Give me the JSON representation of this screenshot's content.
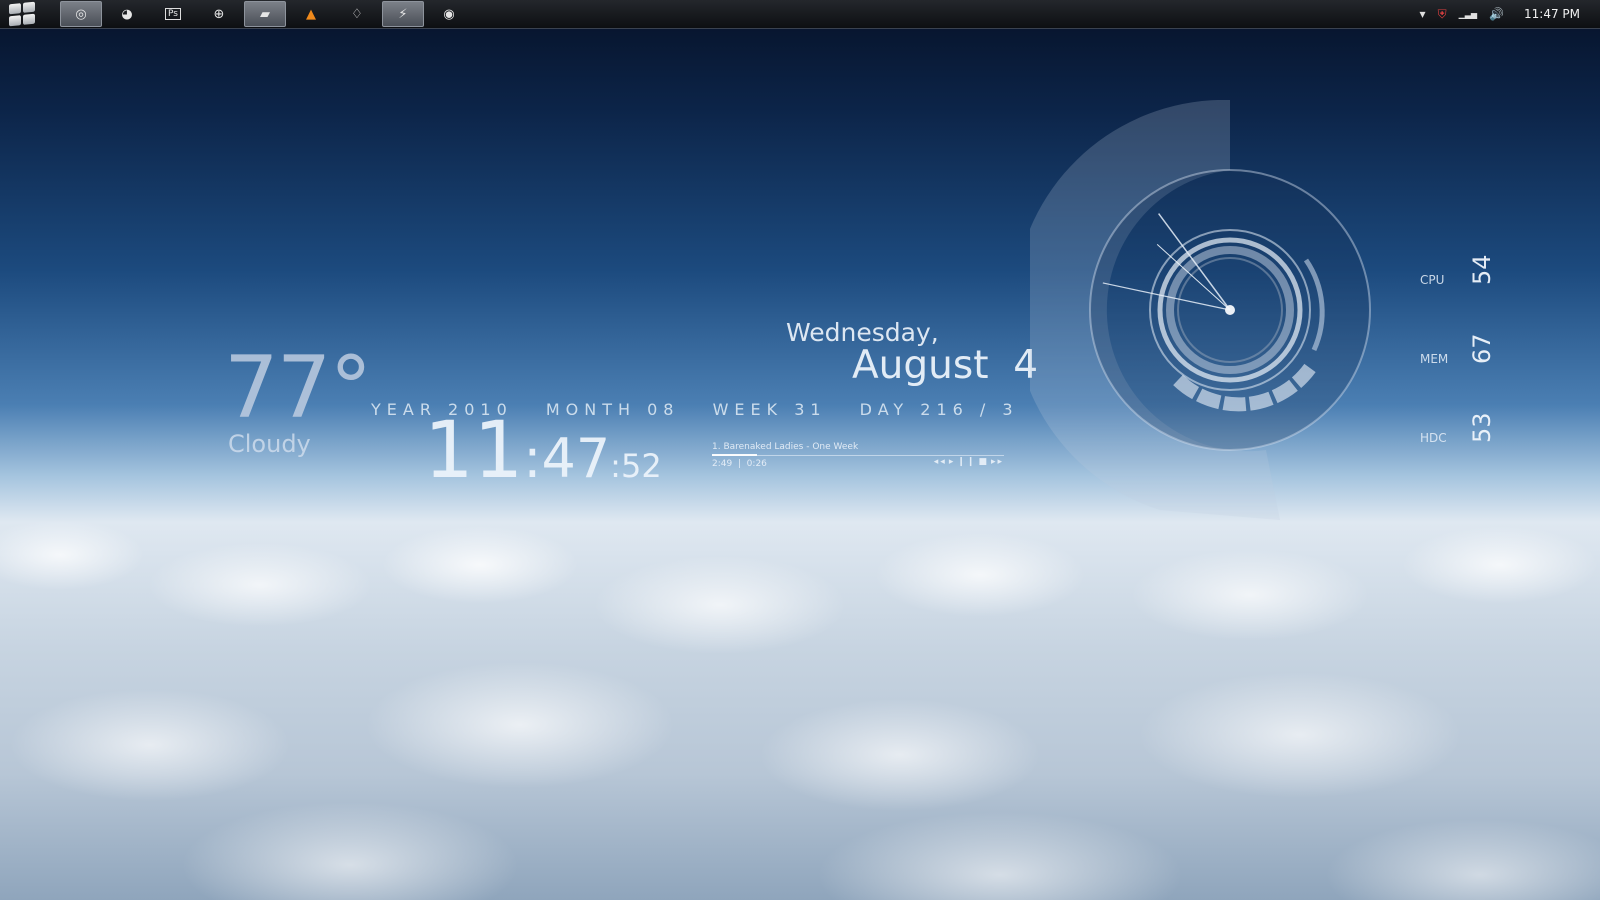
{
  "taskbar": {
    "tasks": [
      {
        "name": "chrome",
        "glyph": "◎",
        "active": true
      },
      {
        "name": "firefox",
        "glyph": "◕",
        "active": false
      },
      {
        "name": "photoshop",
        "glyph": "Ps",
        "active": false
      },
      {
        "name": "browser",
        "glyph": "⊕",
        "active": false
      },
      {
        "name": "folder",
        "glyph": "▰",
        "active": true
      },
      {
        "name": "vlc",
        "glyph": "▲",
        "active": false
      },
      {
        "name": "drop",
        "glyph": "♢",
        "active": false
      },
      {
        "name": "flash",
        "glyph": "⚡",
        "active": true
      },
      {
        "name": "media",
        "glyph": "◉",
        "active": false
      }
    ],
    "tray_icons": [
      "▾",
      "⛨",
      "▁▃▅",
      "🔊"
    ],
    "clock": "11:47 PM"
  },
  "weather": {
    "temp": "77°",
    "condition": "Cloudy"
  },
  "date_strip": {
    "year_label": "YEAR",
    "year": "2010",
    "month_label": "MONTH",
    "month": "08",
    "week_label": "WEEK",
    "week": "31",
    "day_label": "DAY",
    "day": "216 / 3"
  },
  "time": {
    "hour": "11",
    "minute": ":47",
    "second": ":52"
  },
  "date": {
    "weekday": "Wednesday,",
    "month_day": "August  4"
  },
  "player": {
    "track": "1. Barenaked Ladies - One Week",
    "times": "2:49  |  0:26",
    "progress": 0.155,
    "controls": [
      "◂◂",
      "▸",
      "❙❙",
      "■",
      "▸▸"
    ]
  },
  "clock_widget": {
    "hour": 10,
    "minute": 47,
    "second": 52
  },
  "meters": [
    {
      "label": "CPU",
      "value": "54"
    },
    {
      "label": "MEM",
      "value": "67"
    },
    {
      "label": "HDC",
      "value": "53"
    }
  ],
  "colors": {
    "taskbar": "#0d0f12",
    "accent": "#dfe8f1"
  }
}
